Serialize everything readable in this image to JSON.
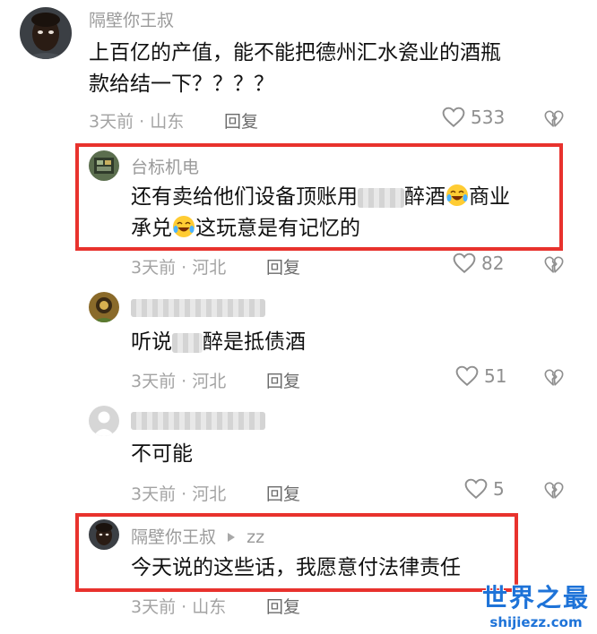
{
  "comments": [
    {
      "username": "隔壁你王叔",
      "text_line1": "上百亿的产值，能不能把德州汇水瓷业的酒瓶",
      "text_line2": "款给结一下？？？？",
      "time_location": "3天前 · 山东",
      "reply_label": "回复",
      "likes": "533"
    },
    {
      "username": "台标机电",
      "text_line1_a": "还有卖给他们设备顶账用",
      "text_line1_b": "醉酒",
      "text_line1_c": "商业",
      "text_line2_a": "承兑",
      "text_line2_b": "这玩意是有记忆的",
      "time_location": "3天前 · 河北",
      "reply_label": "回复",
      "likes": "82"
    },
    {
      "text_a": "听说",
      "text_b": "醉是抵债酒",
      "time_location": "3天前 · 河北",
      "reply_label": "回复",
      "likes": "51"
    },
    {
      "text": "不可能",
      "time_location": "3天前 · 河北",
      "reply_label": "回复",
      "likes": "5"
    },
    {
      "username": "隔壁你王叔",
      "reply_to": "zz",
      "text": "今天说的这些话，我愿意付法律责任",
      "time_location": "3天前 · 山东",
      "reply_label": "回复"
    }
  ],
  "watermark": {
    "main": "世界之最",
    "sub": "shijiezz.com"
  },
  "colors": {
    "highlight_border": "#e8322d",
    "watermark": "#1e73d8"
  }
}
